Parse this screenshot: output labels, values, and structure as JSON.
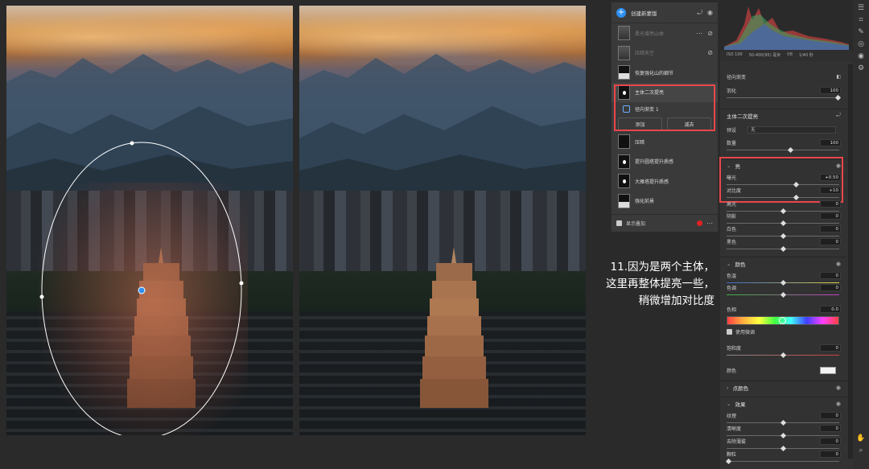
{
  "layers_panel": {
    "title": "创建新蒙版",
    "items": [
      {
        "label": "柔光增亮山体",
        "dim": true
      },
      {
        "label": "压暗天空",
        "dim": true
      },
      {
        "label": "恢复强化山的细节",
        "dim": false
      },
      {
        "label": "主体二次提亮",
        "dim": false
      },
      {
        "label": "压暗",
        "dim": false
      },
      {
        "label": "提升圆塔提升质感",
        "dim": false
      },
      {
        "label": "大雁塔提升质感",
        "dim": false
      },
      {
        "label": "强化前景",
        "dim": false
      }
    ],
    "sub_item": "径向渐变 1",
    "add_button": "添加",
    "subtract_button": "减去",
    "show_overlay": "显示叠加"
  },
  "annotation": {
    "line1": "11.因为是两个主体，",
    "line2": "这里再整体提亮一些，",
    "line3": "稍微增加对比度"
  },
  "histogram_meta": {
    "iso": "ISO 100",
    "lens": "50-400(95) 毫米",
    "aperture": "f/8",
    "shutter": "1/40 秒"
  },
  "adjust_panel": {
    "radial_label": "径向渐变",
    "feather_label": "羽化",
    "feather_value": "100",
    "mask_name": "主体二次提亮",
    "preset_label": "预设",
    "preset_value": "无",
    "amount_label": "数量",
    "amount_value": "100",
    "light_section": "亮",
    "exposure_label": "曝光",
    "exposure_value": "+0.50",
    "contrast_label": "对比度",
    "contrast_value": "+10",
    "highlights_label": "高光",
    "highlights_value": "0",
    "shadows_label": "阴影",
    "shadows_value": "0",
    "whites_label": "白色",
    "whites_value": "0",
    "blacks_label": "黑色",
    "blacks_value": "0",
    "color_section": "颜色",
    "temp_label": "色温",
    "temp_value": "0",
    "tint_label": "色调",
    "tint_value": "0",
    "hue_label": "色相",
    "hue_value": "0.0",
    "smooth_label": "使用微调",
    "saturation_label": "饱和度",
    "saturation_value": "0",
    "color_label": "颜色",
    "point_color_section": "点颜色",
    "effects_section": "效果",
    "texture_label": "纹理",
    "texture_value": "0",
    "clarity_label": "清晰度",
    "clarity_value": "0",
    "dehaze_label": "去除薄雾",
    "dehaze_value": "0",
    "grain_label": "颗粒",
    "grain_value": "0"
  }
}
